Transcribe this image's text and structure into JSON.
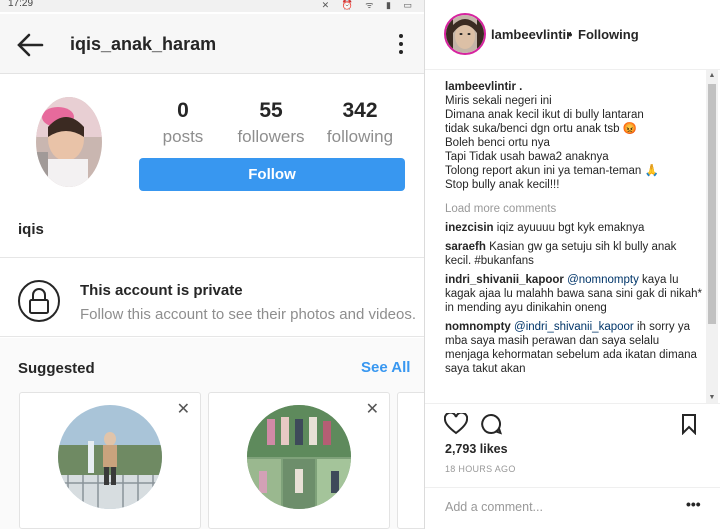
{
  "phone": {
    "status_time": "17:29",
    "status_icons": "✕ ⏰ ᯤ ▮ ▭",
    "header_username": "iqis_anak_haram",
    "stats": {
      "posts": {
        "value": "0",
        "label": "posts"
      },
      "followers": {
        "value": "55",
        "label": "followers"
      },
      "following": {
        "value": "342",
        "label": "following"
      }
    },
    "follow_label": "Follow",
    "profile_name": "iqis",
    "private_title": "This account is private",
    "private_subtitle": "Follow this account to see their photos and videos.",
    "suggested_label": "Suggested",
    "see_all_label": "See All",
    "close_glyph": "✕"
  },
  "post": {
    "username": "lambeevlintir",
    "separator": "•",
    "following_label": "Following",
    "caption_user": "lambeevlintir .",
    "caption_lines": [
      "Miris sekali negeri ini",
      "Dimana anak kecil ikut di bully lantaran",
      "tidak suka/benci dgn ortu anak tsb 😡",
      "Boleh benci ortu nya",
      "Tapi Tidak usah bawa2 anaknya",
      "Tolong report akun ini ya teman-teman 🙏",
      "Stop bully anak kecil!!!"
    ],
    "load_more": "Load more comments",
    "comments": [
      {
        "user": "inezcisin",
        "mention": "",
        "text": "iqiz ayuuuu bgt kyk emaknya"
      },
      {
        "user": "saraefh",
        "mention": "",
        "text": "Kasian gw ga setuju sih kl bully anak kecil. #bukanfans"
      },
      {
        "user": "indri_shivanii_kapoor",
        "mention": "@nomnompty",
        "text": "kaya lu kagak ajaa lu malahh bawa sana sini gak di nikah* in mending ayu dinikahin oneng"
      },
      {
        "user": "nomnompty",
        "mention": "@indri_shivanii_kapoor",
        "text": "ih sorry ya mba saya masih perawan dan saya selalu menjaga kehormatan sebelum ada ikatan dimana saya takut akan"
      }
    ],
    "likes": "2,793 likes",
    "time": "18 HOURS AGO",
    "add_comment_placeholder": "Add a comment...",
    "more_glyph": "•••"
  },
  "colors": {
    "accent": "#3897f0",
    "text": "#262626",
    "muted": "#8e8e8e",
    "mention": "#003569"
  }
}
